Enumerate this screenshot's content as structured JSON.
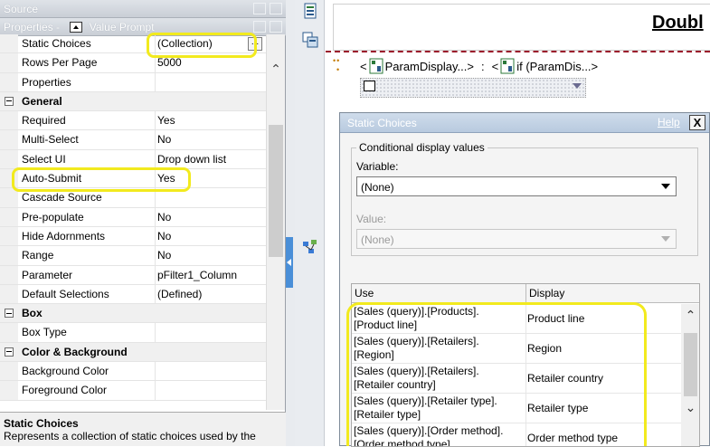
{
  "left_pane": {
    "source_header": "Source",
    "properties_header": "Properties -",
    "object_type": "Value Prompt",
    "rows": [
      {
        "kind": "prop",
        "name": "Static Choices",
        "value": "(Collection)",
        "has_button": true,
        "button_label": "..."
      },
      {
        "kind": "prop",
        "name": "Rows Per Page",
        "value": "5000"
      },
      {
        "kind": "prop",
        "name": "Properties",
        "value": ""
      },
      {
        "kind": "cat",
        "name": "General"
      },
      {
        "kind": "prop",
        "name": "Required",
        "value": "Yes"
      },
      {
        "kind": "prop",
        "name": "Multi-Select",
        "value": "No"
      },
      {
        "kind": "prop",
        "name": "Select UI",
        "value": "Drop down list"
      },
      {
        "kind": "prop",
        "name": "Auto-Submit",
        "value": "Yes"
      },
      {
        "kind": "prop",
        "name": "Cascade Source",
        "value": ""
      },
      {
        "kind": "prop",
        "name": "Pre-populate",
        "value": "No"
      },
      {
        "kind": "prop",
        "name": "Hide Adornments",
        "value": "No"
      },
      {
        "kind": "prop",
        "name": "Range",
        "value": "No"
      },
      {
        "kind": "prop",
        "name": "Parameter",
        "value": "pFilter1_Column"
      },
      {
        "kind": "prop",
        "name": "Default Selections",
        "value": "(Defined)"
      },
      {
        "kind": "cat",
        "name": "Box"
      },
      {
        "kind": "prop",
        "name": "Box Type",
        "value": ""
      },
      {
        "kind": "cat",
        "name": "Color & Background"
      },
      {
        "kind": "prop",
        "name": "Background Color",
        "value": ""
      },
      {
        "kind": "prop",
        "name": "Foreground Color",
        "value": ""
      }
    ],
    "description": {
      "title": "Static Choices",
      "text": "Represents a collection of static choices used by the"
    }
  },
  "canvas": {
    "title": "Doubl",
    "param_display_1": "ParamDisplay...>",
    "separator": ":",
    "param_display_2": "if (ParamDis...>",
    "open_bracket_1": "<",
    "open_bracket_2": "<"
  },
  "dialog": {
    "title": "Static Choices",
    "help": "Help",
    "close": "X",
    "group_label": "Conditional display values",
    "variable_label": "Variable:",
    "variable_value": "(None)",
    "value_label": "Value:",
    "value_value": "(None)",
    "table": {
      "headers": [
        "Use",
        "Display"
      ],
      "rows": [
        {
          "use_1": "[Sales (query)].[Products].",
          "use_2": "[Product line]",
          "display": "Product line"
        },
        {
          "use_1": "[Sales (query)].[Retailers].",
          "use_2": "[Region]",
          "display": "Region"
        },
        {
          "use_1": "[Sales (query)].[Retailers].",
          "use_2": "[Retailer country]",
          "display": "Retailer country"
        },
        {
          "use_1": "[Sales (query)].[Retailer type].",
          "use_2": "[Retailer type]",
          "display": "Retailer type"
        },
        {
          "use_1": "[Sales (query)].[Order method].",
          "use_2": "[Order method type]",
          "display": "Order method type"
        }
      ]
    }
  },
  "colors": {
    "highlight": "#f2ea1e",
    "accent_blue": "#4a8fd8",
    "dashed_line": "#9b1d2c"
  }
}
